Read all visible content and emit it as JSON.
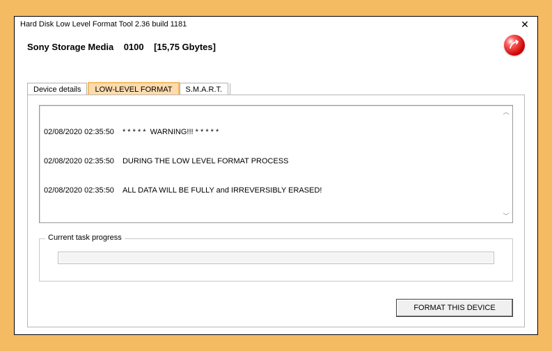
{
  "window": {
    "title": "Hard Disk Low Level Format Tool 2.36 build 1181",
    "close": "✕"
  },
  "device": {
    "name": "Sony Storage Media",
    "code": "0100",
    "size": "[15,75 Gbytes]"
  },
  "tabs": {
    "details": "Device details",
    "format": "LOW-LEVEL FORMAT",
    "smart": "S.M.A.R.T."
  },
  "log": [
    {
      "ts": "02/08/2020 02:35:50",
      "msg": "* * * * *  WARNING!!! * * * * *"
    },
    {
      "ts": "02/08/2020 02:35:50",
      "msg": "DURING THE LOW LEVEL FORMAT PROCESS"
    },
    {
      "ts": "02/08/2020 02:35:50",
      "msg": "ALL DATA WILL BE FULLY and IRREVERSIBLY ERASED!"
    }
  ],
  "progress": {
    "label": "Current task progress"
  },
  "actions": {
    "format_button": "FORMAT THIS DEVICE"
  }
}
